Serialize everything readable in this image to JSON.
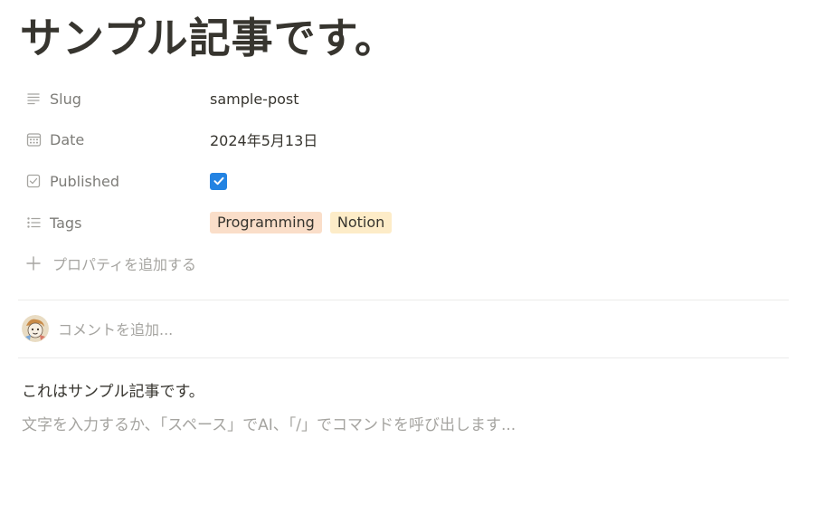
{
  "page": {
    "title": "サンプル記事です。"
  },
  "properties": [
    {
      "icon": "text-lines-icon",
      "name": "Slug",
      "value": "sample-post"
    },
    {
      "icon": "calendar-icon",
      "name": "Date",
      "value": "2024年5月13日"
    },
    {
      "icon": "checkbox-icon",
      "name": "Published",
      "checked": true
    },
    {
      "icon": "list-icon",
      "name": "Tags",
      "tags": [
        "Programming",
        "Notion"
      ]
    }
  ],
  "add_property": {
    "icon": "plus-icon",
    "label": "プロパティを追加する"
  },
  "comment": {
    "placeholder": "コメントを追加..."
  },
  "content": {
    "paragraph": "これはサンプル記事です。",
    "placeholder": "文字を入力するか、「スペース」でAI、「/」でコマンドを呼び出します..."
  },
  "colors": {
    "text": "#37352f",
    "muted": "#7d7c78",
    "placeholder": "#a5a4a0",
    "checkbox": "#2383e2",
    "tag_programming": "#fadec9",
    "tag_notion": "#fdecc8",
    "divider": "#ebebea"
  }
}
